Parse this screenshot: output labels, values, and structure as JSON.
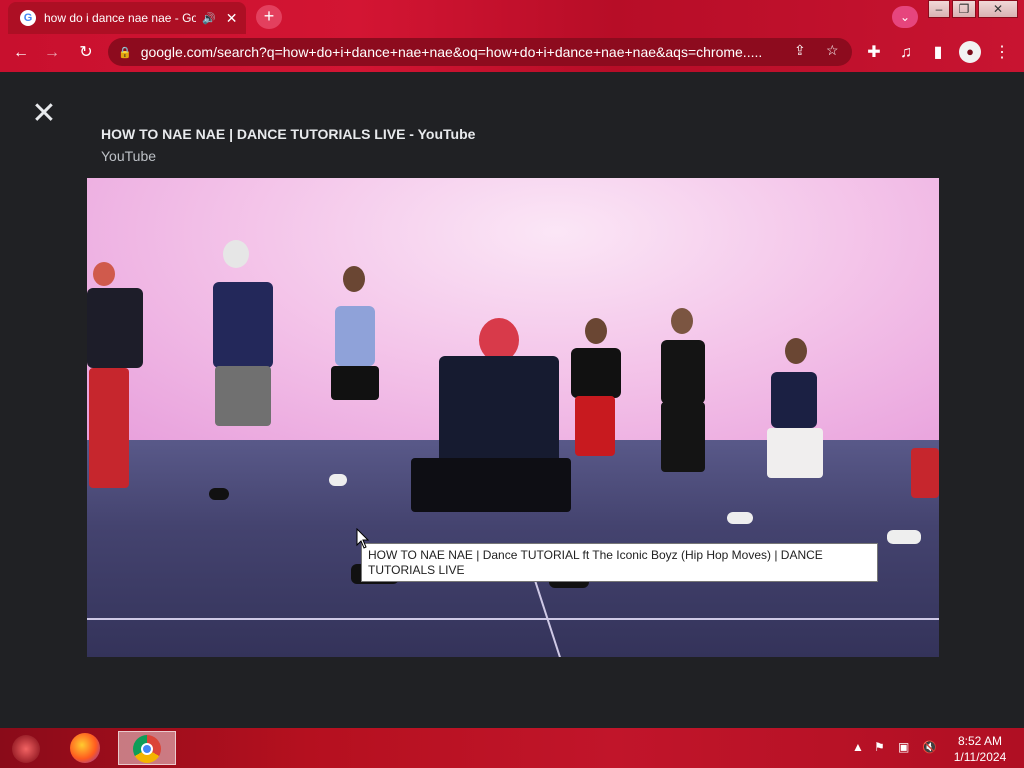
{
  "browser": {
    "tab": {
      "title": "how do i dance nae nae - Go"
    },
    "new_tab_label": "+",
    "address_bar": {
      "url": "google.com/search?q=how+do+i+dance+nae+nae&oq=how+do+i+dance+nae+nae&aqs=chrome....."
    },
    "window_controls": {
      "minimize": "–",
      "maximize": "❐",
      "close": "✕"
    }
  },
  "viewer": {
    "close_label": "✕",
    "title": "HOW TO NAE NAE | DANCE TUTORIALS LIVE - YouTube",
    "source": "YouTube",
    "tooltip": "HOW TO NAE NAE | Dance TUTORIAL ft The Iconic Boyz (Hip Hop Moves) | DANCE TUTORIALS LIVE"
  },
  "taskbar": {
    "clock_time": "8:52 AM",
    "clock_date": "1/11/2024"
  },
  "colors": {
    "chrome_red": "#c8102e",
    "page_bg": "#202124",
    "tooltip_bg": "#ffffff"
  },
  "icons": {
    "back": "back-arrow-icon",
    "forward": "forward-arrow-icon",
    "reload": "reload-icon",
    "lock": "lock-icon",
    "share": "share-icon",
    "bookmark": "star-icon",
    "extensions": "puzzle-icon",
    "media": "media-control-icon",
    "sidepanel": "side-panel-icon",
    "profile": "profile-icon",
    "menu": "kebab-menu-icon"
  }
}
